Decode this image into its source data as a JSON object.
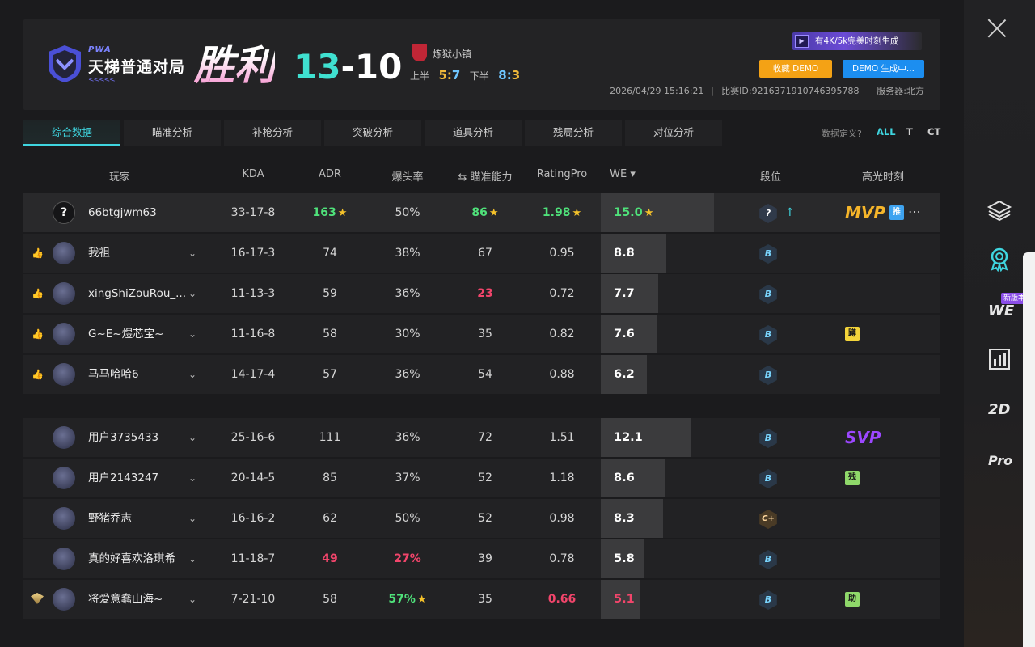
{
  "header": {
    "pwa": "PWA",
    "mode": "天梯普通对局",
    "arrows": "<<<<<",
    "result": "胜利",
    "score_a": "13",
    "score_dash": "-",
    "score_b": "10",
    "map": "炼狱小镇",
    "first_half_label": "上半",
    "first_half_a": "5",
    "first_half_b": "7",
    "second_half_label": "下半",
    "second_half_a": "8",
    "second_half_b": "3",
    "btn_4k": "有4K/5k完美时刻生成",
    "btn_collect": "收藏 DEMO",
    "btn_demo": "DEMO 生成中...",
    "datetime": "2026/04/29 15:16:21",
    "match_id": "比赛ID:9216371910746395788",
    "server": "服务器:北方"
  },
  "tabs": [
    "综合数据",
    "瞄准分析",
    "补枪分析",
    "突破分析",
    "道具分析",
    "残局分析",
    "对位分析"
  ],
  "data_def": "数据定义?",
  "side_filters": [
    "ALL",
    "T",
    "CT"
  ],
  "columns": [
    "玩家",
    "KDA",
    "ADR",
    "爆头率",
    "⇆ 瞄准能力",
    "RatingPro",
    "WE ▾",
    "段位",
    "高光时刻"
  ],
  "team1": [
    {
      "name": "66btgjwm63",
      "kda": "33-17-8",
      "adr": "163",
      "hs": "50%",
      "aim": "86",
      "rating": "1.98",
      "we": "15.0",
      "we_frac": 1.0,
      "rank": "?",
      "highlight": "MVP",
      "badge": "推",
      "badge_color": "blue",
      "me": true
    },
    {
      "name": "我祖",
      "kda": "16-17-3",
      "adr": "74",
      "hs": "38%",
      "aim": "67",
      "rating": "0.95",
      "we": "8.8",
      "we_frac": 0.58,
      "rank": "B",
      "highlight": "",
      "badge": ""
    },
    {
      "name": "xingShiZouRou_...",
      "kda": "11-13-3",
      "adr": "59",
      "hs": "36%",
      "aim": "23",
      "rating": "0.72",
      "we": "7.7",
      "we_frac": 0.51,
      "rank": "B",
      "highlight": "",
      "badge": ""
    },
    {
      "name": "G~E~煜芯宝~",
      "kda": "11-16-8",
      "adr": "58",
      "hs": "30%",
      "aim": "35",
      "rating": "0.82",
      "we": "7.6",
      "we_frac": 0.5,
      "rank": "B",
      "highlight": "",
      "badge": "蹲",
      "badge_color": "yellow"
    },
    {
      "name": "马马哈哈6",
      "kda": "14-17-4",
      "adr": "57",
      "hs": "36%",
      "aim": "54",
      "rating": "0.88",
      "we": "6.2",
      "we_frac": 0.41,
      "rank": "B",
      "highlight": "",
      "badge": ""
    }
  ],
  "team2": [
    {
      "name": "用户3735433",
      "kda": "25-16-6",
      "adr": "111",
      "hs": "36%",
      "aim": "72",
      "rating": "1.51",
      "we": "12.1",
      "we_frac": 0.8,
      "rank": "B",
      "highlight": "SVP",
      "badge": ""
    },
    {
      "name": "用户2143247",
      "kda": "20-14-5",
      "adr": "85",
      "hs": "37%",
      "aim": "52",
      "rating": "1.18",
      "we": "8.6",
      "we_frac": 0.57,
      "rank": "B",
      "highlight": "",
      "badge": "残",
      "badge_color": "green"
    },
    {
      "name": "野猪乔志",
      "kda": "16-16-2",
      "adr": "62",
      "hs": "50%",
      "aim": "52",
      "rating": "0.98",
      "we": "8.3",
      "we_frac": 0.55,
      "rank": "C+",
      "highlight": "",
      "badge": ""
    },
    {
      "name": "真的好喜欢洛琪希",
      "kda": "11-18-7",
      "adr": "49",
      "hs": "27%",
      "aim": "39",
      "rating": "0.78",
      "we": "5.8",
      "we_frac": 0.38,
      "rank": "B",
      "highlight": "",
      "badge": ""
    },
    {
      "name": "将爱意蠢山海~",
      "kda": "7-21-10",
      "adr": "58",
      "hs": "57%",
      "aim": "35",
      "rating": "0.66",
      "we": "5.1",
      "we_frac": 0.34,
      "rank": "B",
      "highlight": "",
      "badge": "助",
      "badge_color": "green"
    }
  ],
  "sidebar": {
    "we": "WE",
    "new": "新版本",
    "d2": "2D",
    "pro": "Pro"
  }
}
